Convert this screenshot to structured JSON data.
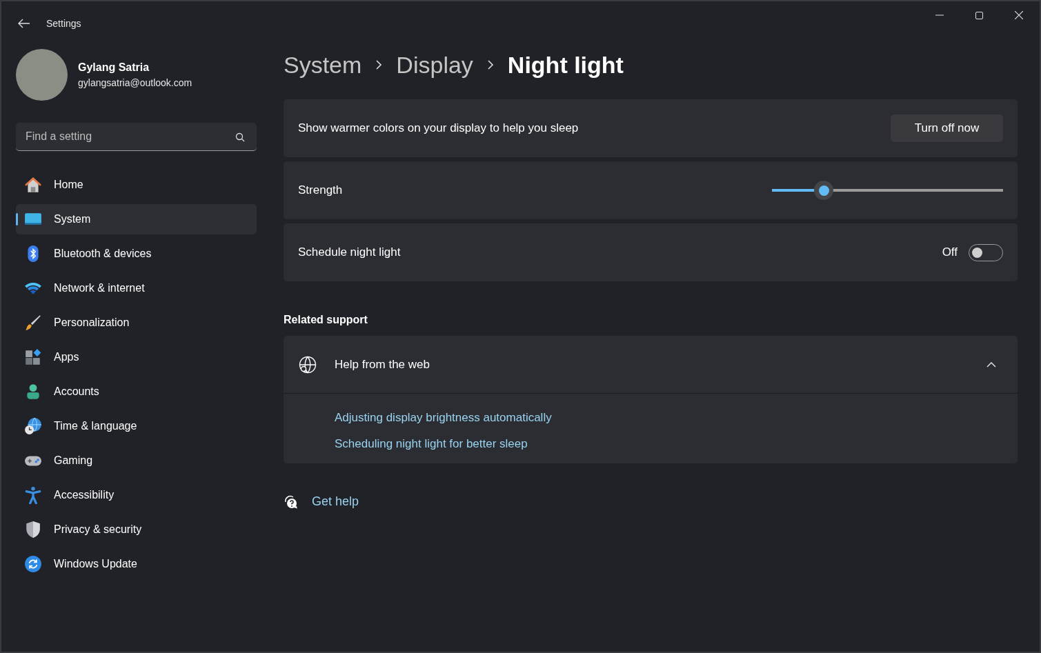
{
  "window": {
    "title": "Settings"
  },
  "account": {
    "name": "Gylang Satria",
    "email": "gylangsatria@outlook.com"
  },
  "search": {
    "placeholder": "Find a setting"
  },
  "sidebar": {
    "items": [
      {
        "label": "Home",
        "kind": "home",
        "selected": false
      },
      {
        "label": "System",
        "kind": "system",
        "selected": true
      },
      {
        "label": "Bluetooth & devices",
        "kind": "bluetooth",
        "selected": false
      },
      {
        "label": "Network & internet",
        "kind": "network",
        "selected": false
      },
      {
        "label": "Personalization",
        "kind": "brush",
        "selected": false
      },
      {
        "label": "Apps",
        "kind": "apps",
        "selected": false
      },
      {
        "label": "Accounts",
        "kind": "accounts",
        "selected": false
      },
      {
        "label": "Time & language",
        "kind": "time",
        "selected": false
      },
      {
        "label": "Gaming",
        "kind": "gaming",
        "selected": false
      },
      {
        "label": "Accessibility",
        "kind": "accessibility",
        "selected": false
      },
      {
        "label": "Privacy & security",
        "kind": "privacy",
        "selected": false
      },
      {
        "label": "Windows Update",
        "kind": "update",
        "selected": false
      }
    ]
  },
  "breadcrumb": [
    "System",
    "Display",
    "Night light"
  ],
  "settings": [
    {
      "kind": "button",
      "label": "Show warmer colors on your display to help you sleep",
      "button": "Turn off now"
    },
    {
      "kind": "slider",
      "label": "Strength",
      "level": 0.2
    },
    {
      "kind": "toggle",
      "label": "Schedule night light",
      "state_text": "Off",
      "on": false
    }
  ],
  "related_support": {
    "heading": "Related support",
    "section": {
      "title": "Help from the web",
      "expanded": true,
      "links": [
        "Adjusting display brightness automatically",
        "Scheduling night light for better sleep"
      ]
    }
  },
  "get_help": "Get help"
}
